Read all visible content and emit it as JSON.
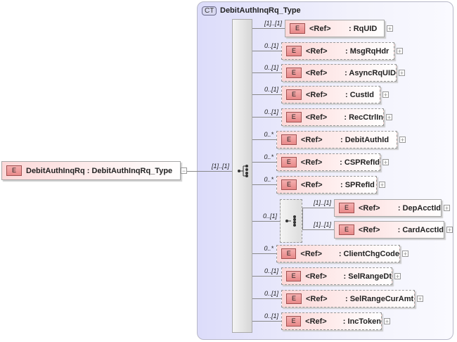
{
  "root": {
    "badge": "E",
    "name": "DebitAuthInqRq",
    "type": ": DebitAuthInqRq_Type",
    "collapse": "−",
    "cardinality": "[1]..[1]"
  },
  "complex_type": {
    "badge": "CT",
    "name": "DebitAuthInqRq_Type"
  },
  "children": [
    {
      "badge": "E",
      "ref": "<Ref>",
      "name": ": RqUID",
      "card": "[1]..[1]",
      "expand": "+"
    },
    {
      "badge": "E",
      "ref": "<Ref>",
      "name": ": MsgRqHdr",
      "card": "0..[1]",
      "expand": "+"
    },
    {
      "badge": "E",
      "ref": "<Ref>",
      "name": ": AsyncRqUID",
      "card": "0..[1]",
      "expand": "+"
    },
    {
      "badge": "E",
      "ref": "<Ref>",
      "name": ": CustId",
      "card": "0..[1]",
      "expand": "+"
    },
    {
      "badge": "E",
      "ref": "<Ref>",
      "name": ": RecCtrlIn",
      "card": "0..[1]",
      "expand": "+"
    },
    {
      "badge": "E",
      "ref": "<Ref>",
      "name": ": DebitAuthId",
      "card": "0..*",
      "expand": "+"
    },
    {
      "badge": "E",
      "ref": "<Ref>",
      "name": ": CSPRefId",
      "card": "0..*",
      "expand": "+"
    },
    {
      "badge": "E",
      "ref": "<Ref>",
      "name": ": SPRefId",
      "card": "0..*",
      "expand": "+"
    },
    {
      "badge": "E",
      "ref": "<Ref>",
      "name": ": ClientChgCode",
      "card": "0..*",
      "expand": "+"
    },
    {
      "badge": "E",
      "ref": "<Ref>",
      "name": ": SelRangeDt",
      "card": "0..[1]",
      "expand": "+"
    },
    {
      "badge": "E",
      "ref": "<Ref>",
      "name": ": SelRangeCurAmt",
      "card": "0..[1]",
      "expand": "+"
    },
    {
      "badge": "E",
      "ref": "<Ref>",
      "name": ": IncToken",
      "card": "0..[1]",
      "expand": "+"
    }
  ],
  "choice": {
    "card": "0..[1]",
    "icon": "choice-icon",
    "options": [
      {
        "badge": "E",
        "ref": "<Ref>",
        "name": ": DepAcctId",
        "card": "[1]..[1]",
        "expand": "+"
      },
      {
        "badge": "E",
        "ref": "<Ref>",
        "name": ": CardAcctId",
        "card": "[1]..[1]",
        "expand": "+"
      }
    ]
  }
}
